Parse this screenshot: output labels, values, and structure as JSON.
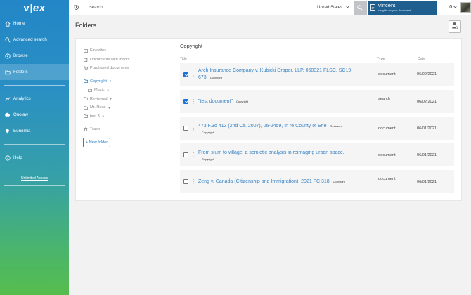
{
  "brand": {
    "logo_v": "v",
    "logo_x": "|ex"
  },
  "sidebar": {
    "items": [
      {
        "label": "Home",
        "icon": "home-icon"
      },
      {
        "label": "Advanced search",
        "icon": "search-icon"
      },
      {
        "label": "Browse",
        "icon": "compass-icon"
      },
      {
        "label": "Folders",
        "icon": "folder-icon",
        "active": true
      },
      {
        "label": "Analytics",
        "icon": "analytics-icon"
      },
      {
        "label": "Quolaw",
        "icon": "cloud-icon"
      },
      {
        "label": "Eunomia",
        "icon": "bulb-icon"
      },
      {
        "label": "Help",
        "icon": "info-icon"
      }
    ],
    "unlimited_access": "Unlimited Access"
  },
  "topbar": {
    "search_placeholder": "Search",
    "country": "United States",
    "user_name": "Vincent",
    "user_subtitle": "Insights on your document",
    "notifications": "0"
  },
  "page": {
    "title": "Folders"
  },
  "tree": {
    "favorites": "Favorites",
    "documents_with_marks": "Documents with marks",
    "purchased_documents": "Purchased documents",
    "folders": [
      {
        "label": "Copyright",
        "active": true,
        "caret": true
      },
      {
        "label": "Music",
        "sub": true,
        "caret": true
      },
      {
        "label": "Reviewed",
        "caret": true
      },
      {
        "label": "Mr. Roux",
        "caret": true
      },
      {
        "label": "test 3",
        "caret": true
      }
    ],
    "trash": "Trash",
    "new_folder": "+ New folder"
  },
  "list": {
    "title": "Copyright",
    "columns": {
      "title": "Title",
      "type": "Type",
      "date": "Date"
    },
    "rows": [
      {
        "checked": true,
        "title": "Arch Insurance Company v. Kubicki Draper, LLP, 060321 FLSC, SC19-673",
        "tag": "Copyright",
        "type": "document",
        "date": "06/09/2021"
      },
      {
        "checked": true,
        "title": "\"test document\"",
        "tag": "Copyright",
        "type": "search",
        "date": "06/02/2021"
      },
      {
        "checked": false,
        "title": "473 F.3d 413 (2nd Cir. 2007), 06-2459, In re County of Erie",
        "tag": "Reviewed",
        "tag2": "Copyright",
        "type": "document",
        "date": "06/01/2021"
      },
      {
        "checked": false,
        "title": "From slum to village: a semiotic analysis in reimaging urban space.",
        "tag": "Copyright",
        "type": "document",
        "date": "06/01/2021"
      },
      {
        "checked": false,
        "title": "Zeng v. Canada (Citizenship and Immigration), 2021 FC 318",
        "tag": "Copyright",
        "type": "document",
        "date": "06/01/2021"
      }
    ]
  },
  "colors": {
    "accent": "#2f83c3",
    "user_box": "#1f5f8f",
    "checkbox": "#1a73d9"
  }
}
